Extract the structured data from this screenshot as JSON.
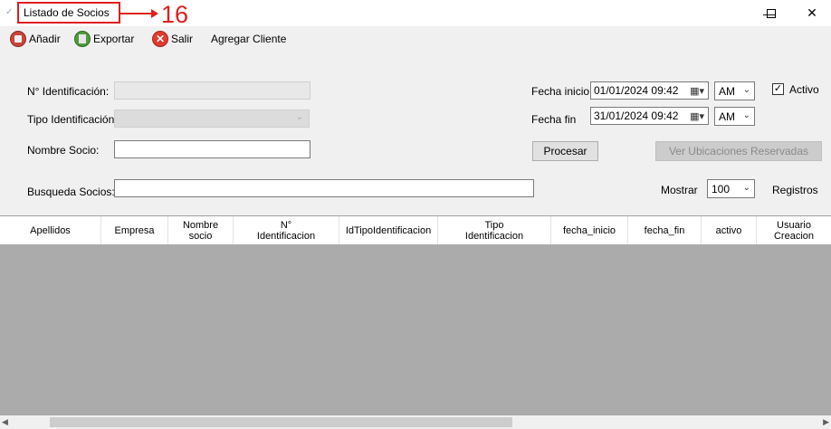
{
  "window": {
    "title": "Listado de Socios",
    "annotation_number": "16",
    "annotation_color": "#e01e1e"
  },
  "toolbar": {
    "add_label": "Añadir",
    "export_label": "Exportar",
    "exit_label": "Salir",
    "add_client_label": "Agregar Cliente"
  },
  "form": {
    "id_label": "N° Identificación:",
    "id_value": "",
    "id_type_label": "Tipo Identificación:",
    "id_type_value": "",
    "name_label": "Nombre Socio:",
    "name_value": "",
    "search_label": "Busqueda Socios:",
    "search_value": "",
    "start_date_label": "Fecha inicio",
    "start_date_value": "01/01/2024 09:42",
    "start_ampm": "AM",
    "end_date_label": "Fecha fin",
    "end_date_value": "31/01/2024 09:42",
    "end_ampm": "AM",
    "active_label": "Activo",
    "active_checked": true,
    "process_button": "Procesar",
    "reserved_button": "Ver Ubicaciones Reservadas",
    "show_label": "Mostrar",
    "show_value": "100",
    "records_label": "Registros"
  },
  "grid": {
    "columns": [
      {
        "label": "Apellidos"
      },
      {
        "label": "Empresa"
      },
      {
        "label": "Nombre\nsocio"
      },
      {
        "label": "N°\nIdentificacion"
      },
      {
        "label": "IdTipoIdentificacion"
      },
      {
        "label": "Tipo\nIdentificacion"
      },
      {
        "label": "fecha_inicio"
      },
      {
        "label": "fecha_fin"
      },
      {
        "label": "activo"
      },
      {
        "label": "Usuario\nCreacion"
      }
    ]
  }
}
